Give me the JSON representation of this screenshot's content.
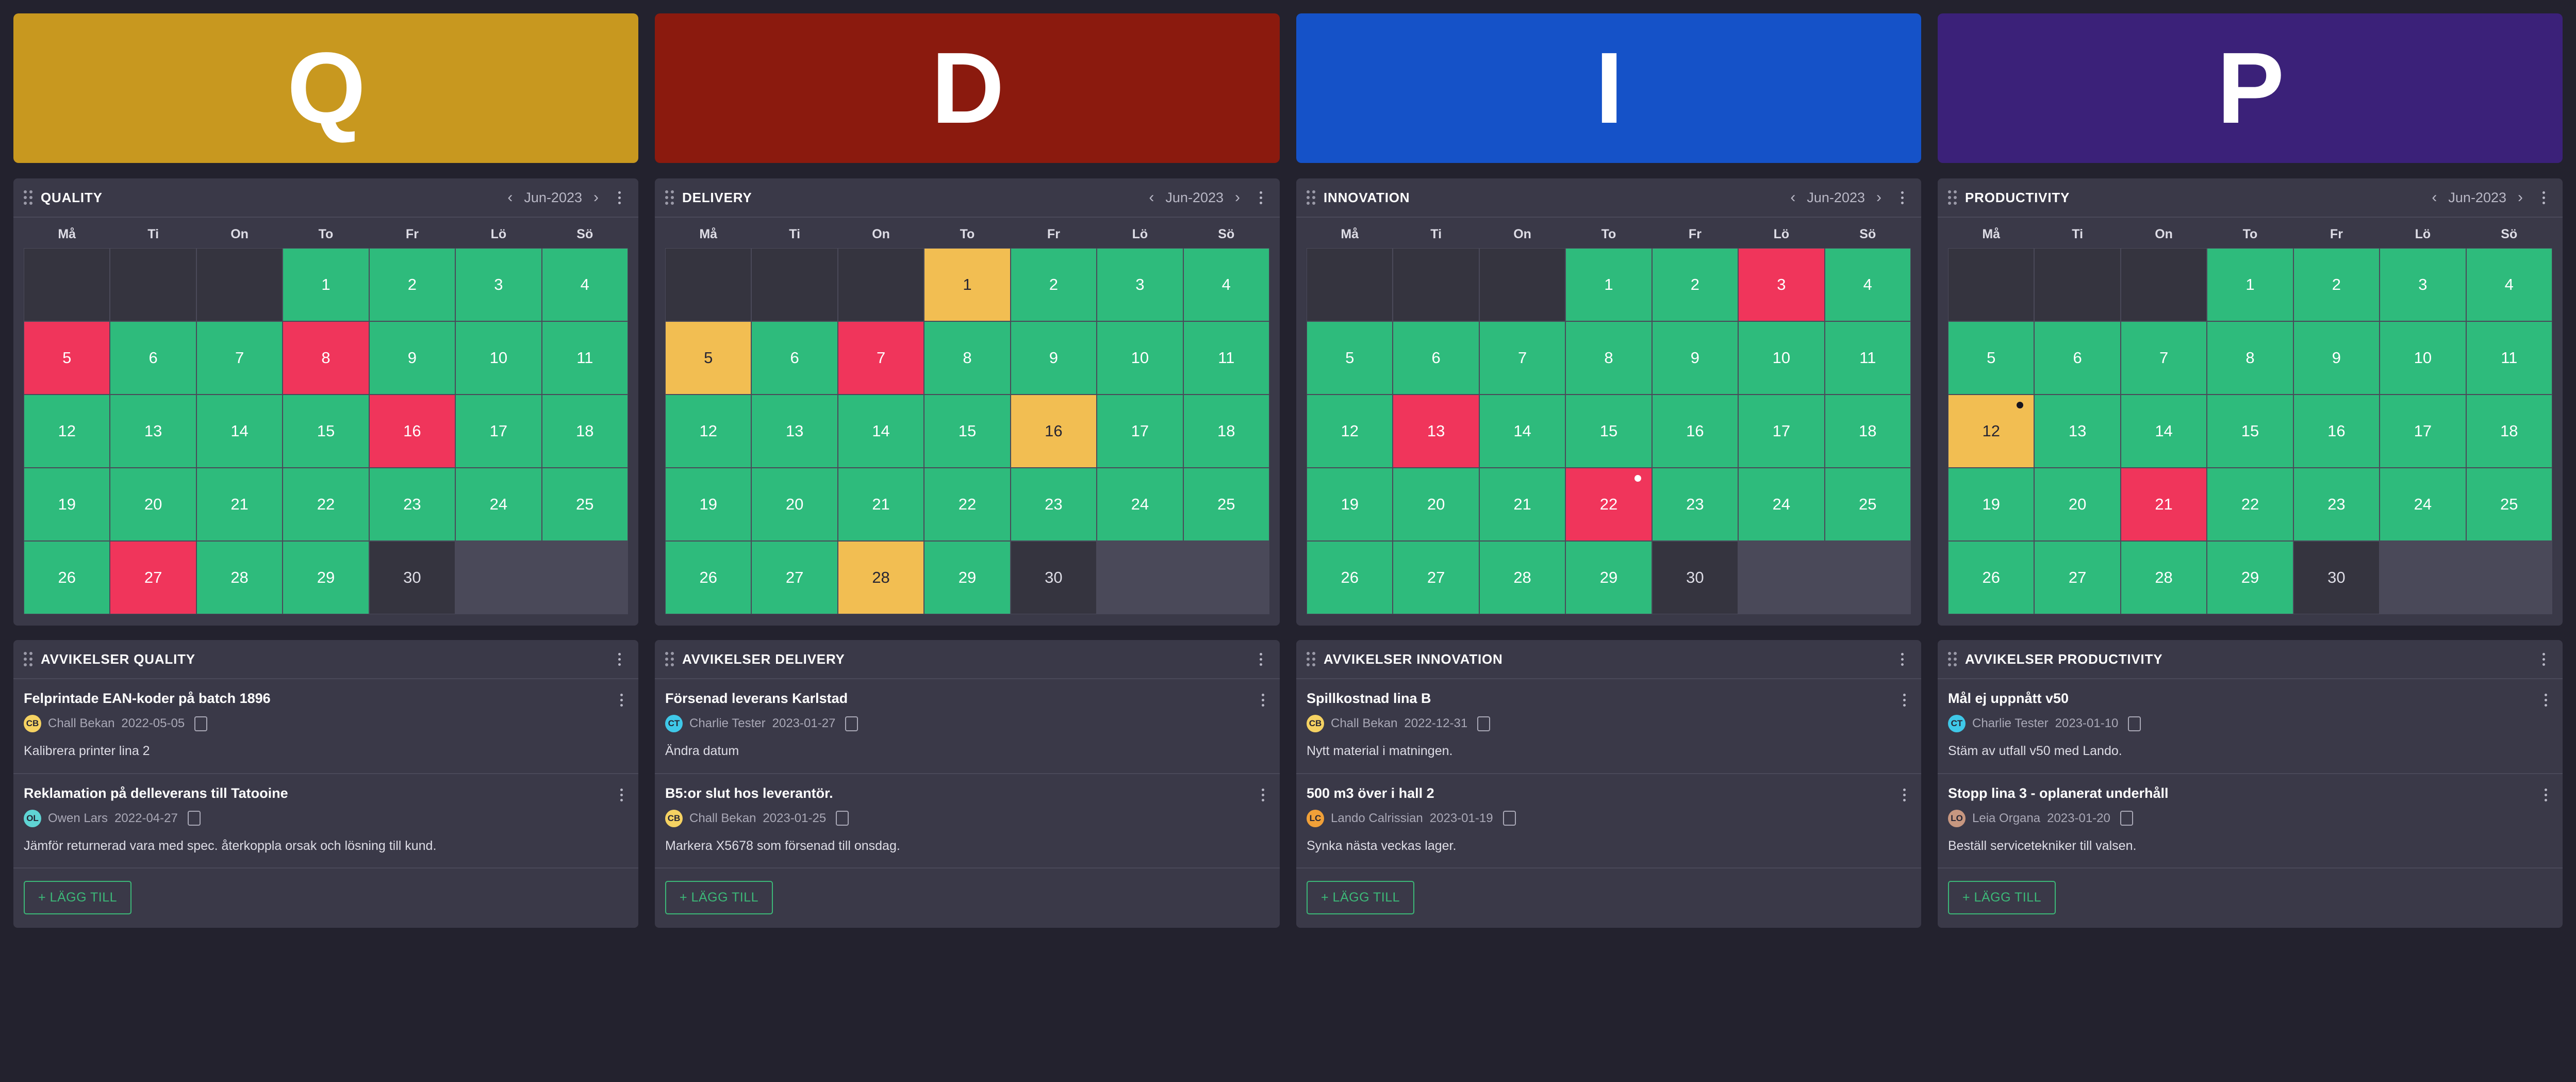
{
  "theme": {
    "page_bg": "#23222e",
    "card_bg": "#3a3948",
    "green": "#2ebb7c",
    "red": "#f0355b",
    "yellow": "#f2be52",
    "accent_green": "#3cb878"
  },
  "columns": [
    {
      "banner": {
        "letter": "Q",
        "color": "#c8981f"
      },
      "calendar": {
        "title": "QUALITY",
        "month": "Jun-2023",
        "prev_label": "‹",
        "next_label": "›",
        "weekdays": [
          "Må",
          "Ti",
          "On",
          "To",
          "Fr",
          "Lö",
          "Sö"
        ],
        "lead_blanks": 3,
        "days": [
          {
            "n": 1,
            "status": "green"
          },
          {
            "n": 2,
            "status": "green"
          },
          {
            "n": 3,
            "status": "green"
          },
          {
            "n": 4,
            "status": "green"
          },
          {
            "n": 5,
            "status": "red"
          },
          {
            "n": 6,
            "status": "green"
          },
          {
            "n": 7,
            "status": "green"
          },
          {
            "n": 8,
            "status": "red"
          },
          {
            "n": 9,
            "status": "green"
          },
          {
            "n": 10,
            "status": "green"
          },
          {
            "n": 11,
            "status": "green"
          },
          {
            "n": 12,
            "status": "green"
          },
          {
            "n": 13,
            "status": "green"
          },
          {
            "n": 14,
            "status": "green"
          },
          {
            "n": 15,
            "status": "green"
          },
          {
            "n": 16,
            "status": "red"
          },
          {
            "n": 17,
            "status": "green"
          },
          {
            "n": 18,
            "status": "green"
          },
          {
            "n": 19,
            "status": "green"
          },
          {
            "n": 20,
            "status": "green"
          },
          {
            "n": 21,
            "status": "green"
          },
          {
            "n": 22,
            "status": "green"
          },
          {
            "n": 23,
            "status": "green"
          },
          {
            "n": 24,
            "status": "green"
          },
          {
            "n": 25,
            "status": "green"
          },
          {
            "n": 26,
            "status": "green"
          },
          {
            "n": 27,
            "status": "red"
          },
          {
            "n": 28,
            "status": "green"
          },
          {
            "n": 29,
            "status": "green"
          },
          {
            "n": 30,
            "status": "none"
          }
        ]
      },
      "deviations": {
        "title": "AVVIKELSER QUALITY",
        "add_label": "+ LÄGG TILL",
        "items": [
          {
            "title": "Felprintade EAN-koder på batch 1896",
            "initials": "CB",
            "avatar_color": "#f5d262",
            "name": "Chall Bekan",
            "date": "2022-05-05",
            "desc": "Kalibrera printer lina 2"
          },
          {
            "title": "Reklamation på delleverans till Tatooine",
            "initials": "OL",
            "avatar_color": "#5fd4d4",
            "name": "Owen Lars",
            "date": "2022-04-27",
            "desc": "Jämför returnerad vara med spec. återkoppla orsak och lösning till kund."
          }
        ]
      }
    },
    {
      "banner": {
        "letter": "D",
        "color": "#8b1a0e"
      },
      "calendar": {
        "title": "DELIVERY",
        "month": "Jun-2023",
        "prev_label": "‹",
        "next_label": "›",
        "weekdays": [
          "Må",
          "Ti",
          "On",
          "To",
          "Fr",
          "Lö",
          "Sö"
        ],
        "lead_blanks": 3,
        "days": [
          {
            "n": 1,
            "status": "yellow"
          },
          {
            "n": 2,
            "status": "green"
          },
          {
            "n": 3,
            "status": "green"
          },
          {
            "n": 4,
            "status": "green"
          },
          {
            "n": 5,
            "status": "yellow"
          },
          {
            "n": 6,
            "status": "green"
          },
          {
            "n": 7,
            "status": "red"
          },
          {
            "n": 8,
            "status": "green"
          },
          {
            "n": 9,
            "status": "green"
          },
          {
            "n": 10,
            "status": "green"
          },
          {
            "n": 11,
            "status": "green"
          },
          {
            "n": 12,
            "status": "green"
          },
          {
            "n": 13,
            "status": "green"
          },
          {
            "n": 14,
            "status": "green"
          },
          {
            "n": 15,
            "status": "green"
          },
          {
            "n": 16,
            "status": "yellow"
          },
          {
            "n": 17,
            "status": "green"
          },
          {
            "n": 18,
            "status": "green"
          },
          {
            "n": 19,
            "status": "green"
          },
          {
            "n": 20,
            "status": "green"
          },
          {
            "n": 21,
            "status": "green"
          },
          {
            "n": 22,
            "status": "green"
          },
          {
            "n": 23,
            "status": "green"
          },
          {
            "n": 24,
            "status": "green"
          },
          {
            "n": 25,
            "status": "green"
          },
          {
            "n": 26,
            "status": "green"
          },
          {
            "n": 27,
            "status": "green"
          },
          {
            "n": 28,
            "status": "yellow"
          },
          {
            "n": 29,
            "status": "green"
          },
          {
            "n": 30,
            "status": "none"
          }
        ]
      },
      "deviations": {
        "title": "AVVIKELSER DELIVERY",
        "add_label": "+ LÄGG TILL",
        "items": [
          {
            "title": "Försenad leverans Karlstad",
            "initials": "CT",
            "avatar_color": "#3fc8e8",
            "name": "Charlie Tester",
            "date": "2023-01-27",
            "desc": "Ändra datum"
          },
          {
            "title": "B5:or slut hos leverantör.",
            "initials": "CB",
            "avatar_color": "#f5d262",
            "name": "Chall Bekan",
            "date": "2023-01-25",
            "desc": "Markera X5678 som försenad till onsdag."
          }
        ]
      }
    },
    {
      "banner": {
        "letter": "I",
        "color": "#1552c8"
      },
      "calendar": {
        "title": "INNOVATION",
        "month": "Jun-2023",
        "prev_label": "‹",
        "next_label": "›",
        "weekdays": [
          "Må",
          "Ti",
          "On",
          "To",
          "Fr",
          "Lö",
          "Sö"
        ],
        "lead_blanks": 3,
        "days": [
          {
            "n": 1,
            "status": "green"
          },
          {
            "n": 2,
            "status": "green"
          },
          {
            "n": 3,
            "status": "red"
          },
          {
            "n": 4,
            "status": "green"
          },
          {
            "n": 5,
            "status": "green"
          },
          {
            "n": 6,
            "status": "green"
          },
          {
            "n": 7,
            "status": "green"
          },
          {
            "n": 8,
            "status": "green"
          },
          {
            "n": 9,
            "status": "green"
          },
          {
            "n": 10,
            "status": "green"
          },
          {
            "n": 11,
            "status": "green"
          },
          {
            "n": 12,
            "status": "green"
          },
          {
            "n": 13,
            "status": "red"
          },
          {
            "n": 14,
            "status": "green"
          },
          {
            "n": 15,
            "status": "green"
          },
          {
            "n": 16,
            "status": "green"
          },
          {
            "n": 17,
            "status": "green"
          },
          {
            "n": 18,
            "status": "green"
          },
          {
            "n": 19,
            "status": "green"
          },
          {
            "n": 20,
            "status": "green"
          },
          {
            "n": 21,
            "status": "green"
          },
          {
            "n": 22,
            "status": "red",
            "dot": "white"
          },
          {
            "n": 23,
            "status": "green"
          },
          {
            "n": 24,
            "status": "green"
          },
          {
            "n": 25,
            "status": "green"
          },
          {
            "n": 26,
            "status": "green"
          },
          {
            "n": 27,
            "status": "green"
          },
          {
            "n": 28,
            "status": "green"
          },
          {
            "n": 29,
            "status": "green"
          },
          {
            "n": 30,
            "status": "none"
          }
        ]
      },
      "deviations": {
        "title": "AVVIKELSER INNOVATION",
        "add_label": "+ LÄGG TILL",
        "items": [
          {
            "title": "Spillkostnad lina B",
            "initials": "CB",
            "avatar_color": "#f5d262",
            "name": "Chall Bekan",
            "date": "2022-12-31",
            "desc": "Nytt material i matningen."
          },
          {
            "title": "500 m3 över i hall 2",
            "initials": "LC",
            "avatar_color": "#f0a038",
            "name": "Lando Calrissian",
            "date": "2023-01-19",
            "desc": "Synka nästa veckas lager."
          }
        ]
      }
    },
    {
      "banner": {
        "letter": "P",
        "color": "#3b2179"
      },
      "calendar": {
        "title": "PRODUCTIVITY",
        "month": "Jun-2023",
        "prev_label": "‹",
        "next_label": "›",
        "weekdays": [
          "Må",
          "Ti",
          "On",
          "To",
          "Fr",
          "Lö",
          "Sö"
        ],
        "lead_blanks": 3,
        "days": [
          {
            "n": 1,
            "status": "green"
          },
          {
            "n": 2,
            "status": "green"
          },
          {
            "n": 3,
            "status": "green"
          },
          {
            "n": 4,
            "status": "green"
          },
          {
            "n": 5,
            "status": "green"
          },
          {
            "n": 6,
            "status": "green"
          },
          {
            "n": 7,
            "status": "green"
          },
          {
            "n": 8,
            "status": "green"
          },
          {
            "n": 9,
            "status": "green"
          },
          {
            "n": 10,
            "status": "green"
          },
          {
            "n": 11,
            "status": "green"
          },
          {
            "n": 12,
            "status": "yellow",
            "dot": "black"
          },
          {
            "n": 13,
            "status": "green"
          },
          {
            "n": 14,
            "status": "green"
          },
          {
            "n": 15,
            "status": "green"
          },
          {
            "n": 16,
            "status": "green"
          },
          {
            "n": 17,
            "status": "green"
          },
          {
            "n": 18,
            "status": "green"
          },
          {
            "n": 19,
            "status": "green"
          },
          {
            "n": 20,
            "status": "green"
          },
          {
            "n": 21,
            "status": "red"
          },
          {
            "n": 22,
            "status": "green"
          },
          {
            "n": 23,
            "status": "green"
          },
          {
            "n": 24,
            "status": "green"
          },
          {
            "n": 25,
            "status": "green"
          },
          {
            "n": 26,
            "status": "green"
          },
          {
            "n": 27,
            "status": "green"
          },
          {
            "n": 28,
            "status": "green"
          },
          {
            "n": 29,
            "status": "green"
          },
          {
            "n": 30,
            "status": "none"
          }
        ]
      },
      "deviations": {
        "title": "AVVIKELSER PRODUCTIVITY",
        "add_label": "+ LÄGG TILL",
        "items": [
          {
            "title": "Mål ej uppnått v50",
            "initials": "CT",
            "avatar_color": "#3fc8e8",
            "name": "Charlie Tester",
            "date": "2023-01-10",
            "desc": "Stäm av utfall v50 med Lando."
          },
          {
            "title": "Stopp lina 3 - oplanerat underhåll",
            "initials": "LO",
            "avatar_color": "#c79780",
            "name": "Leia Organa",
            "date": "2023-01-20",
            "desc": "Beställ servicetekniker till valsen."
          }
        ]
      }
    }
  ]
}
